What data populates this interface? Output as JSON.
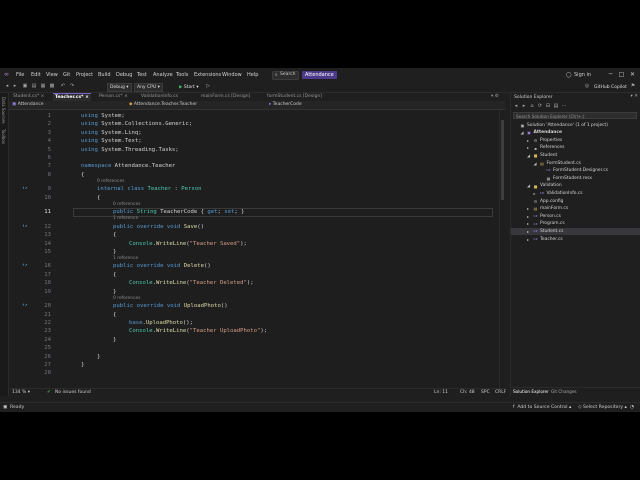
{
  "menu": [
    "File",
    "Edit",
    "View",
    "Git",
    "Project",
    "Build",
    "Debug",
    "Test",
    "Analyze",
    "Tools",
    "Extensions",
    "Window",
    "Help"
  ],
  "search_label": "Search",
  "solution_name": "Attendance",
  "signin": "Sign in",
  "copilot": "GitHub Copilot",
  "toolbar": {
    "config": "Debug",
    "platform": "Any CPU",
    "start": "Start"
  },
  "left_strip": [
    "Data Sources",
    "Toolbox"
  ],
  "tabs": [
    "Student.cs*",
    "Teacher.cs*",
    "Person.cs*",
    "ValidationInfo.cs",
    "mainForm.cs [Design]",
    "formStudent.cs [Design]"
  ],
  "nav": {
    "project": "Attendance",
    "class": "Attendance.Teacher.Teacher",
    "member": "TeacherCode"
  },
  "code_lines": [
    {
      "n": "1",
      "t": "using System;"
    },
    {
      "n": "2",
      "t": "using System.Collections.Generic;"
    },
    {
      "n": "3",
      "t": "using System.Linq;"
    },
    {
      "n": "4",
      "t": "using System.Text;"
    },
    {
      "n": "5",
      "t": "using System.Threading.Tasks;"
    },
    {
      "n": "6",
      "t": ""
    },
    {
      "n": "7",
      "t": "namespace Attendance.Teacher"
    },
    {
      "n": "8",
      "t": "{"
    },
    {
      "n": "9",
      "t": "internal class Teacher : Person",
      "ref": "0 references"
    },
    {
      "n": "10",
      "t": "{"
    },
    {
      "n": "11",
      "t": "public String TeacherCode { get; set; }",
      "ref": "0 references"
    },
    {
      "n": "12",
      "t": "public override void Save()",
      "ref": "1 reference"
    },
    {
      "n": "13",
      "t": "{"
    },
    {
      "n": "14",
      "t": "Console.WriteLine(\"Teacher Saved\");"
    },
    {
      "n": "15",
      "t": "}"
    },
    {
      "n": "16",
      "t": "public override void Delete()",
      "ref": "1 reference"
    },
    {
      "n": "17",
      "t": "{"
    },
    {
      "n": "18",
      "t": "Console.WriteLine(\"Teacher Deleted\");"
    },
    {
      "n": "19",
      "t": "}"
    },
    {
      "n": "20",
      "t": "public override void UploadPhoto()",
      "ref": "0 references"
    },
    {
      "n": "21",
      "t": "{"
    },
    {
      "n": "22",
      "t": "base.UploadPhoto();"
    },
    {
      "n": "23",
      "t": "Console.WriteLine(\"Teacher UploadPhoto\");"
    },
    {
      "n": "24",
      "t": "}"
    },
    {
      "n": "25",
      "t": ""
    },
    {
      "n": "26",
      "t": "}"
    },
    {
      "n": "27",
      "t": "}"
    },
    {
      "n": "28",
      "t": ""
    }
  ],
  "editor_status": {
    "zoom": "134 %",
    "issues": "No issues found",
    "ln": "Ln: 11",
    "ch": "Ch: 48",
    "spc": "SPC",
    "crlf": "CRLF"
  },
  "solution_explorer": {
    "title": "Solution Explorer",
    "search_placeholder": "Search Solution Explorer (Ctrl+;)",
    "items": [
      {
        "label": "Solution 'Attendance' (1 of 1 project)"
      },
      {
        "label": "Attendance"
      },
      {
        "label": "Properties"
      },
      {
        "label": "References"
      },
      {
        "label": "Student"
      },
      {
        "label": "FormStudent.cs"
      },
      {
        "label": "FormStudent.Designer.cs"
      },
      {
        "label": "FormStudent.resx"
      },
      {
        "label": "Validation"
      },
      {
        "label": "ValidationInfo.cs"
      },
      {
        "label": "App.config"
      },
      {
        "label": "mainForm.cs"
      },
      {
        "label": "Person.cs"
      },
      {
        "label": "Program.cs"
      },
      {
        "label": "Student.cs"
      },
      {
        "label": "Teacher.cs"
      }
    ],
    "tabs": [
      "Solution Explorer",
      "Git Changes"
    ]
  },
  "statusbar": {
    "ready": "Ready",
    "source_control": "Add to Source Control",
    "repo": "Select Repository"
  }
}
